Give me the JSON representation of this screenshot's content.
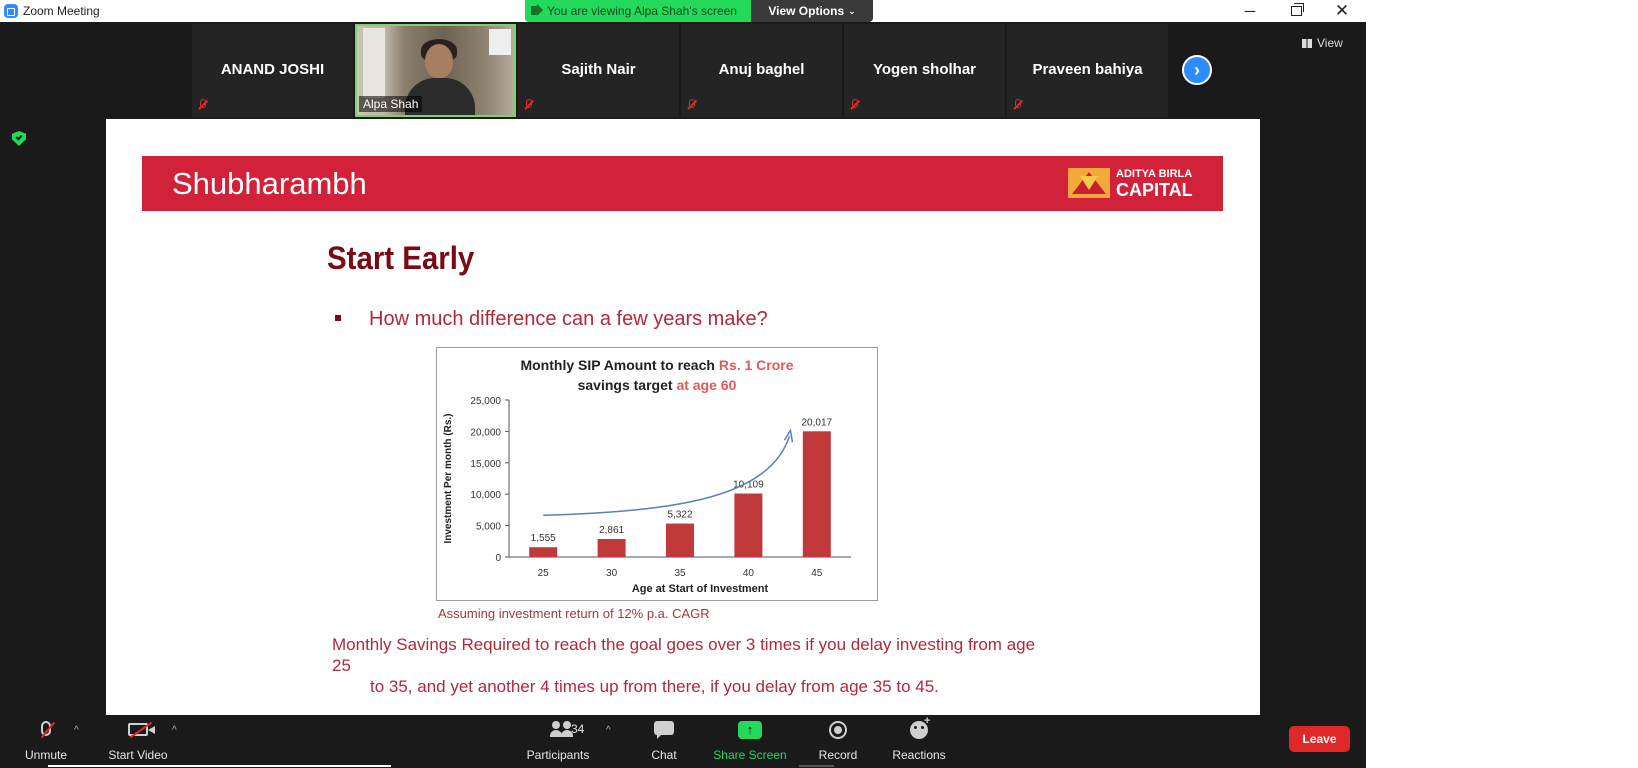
{
  "window": {
    "title": "Zoom Meeting"
  },
  "banner": {
    "viewing_text": "You are viewing Alpa Shah's screen",
    "view_options": "View Options"
  },
  "participants": [
    {
      "name": "ANAND JOSHI"
    },
    {
      "name": "Alpa Shah"
    },
    {
      "name": "Sajith Nair"
    },
    {
      "name": "Anuj baghel"
    },
    {
      "name": "Yogen sholhar"
    },
    {
      "name": "Praveen bahiya"
    }
  ],
  "view_label": "View",
  "slide": {
    "brand": "Shubharambh",
    "logo": {
      "line1": "ADITYA BIRLA",
      "line2": "CAPITAL"
    },
    "title": "Start Early",
    "bullet": "How much difference can a few years make?",
    "footnote": "Assuming investment return of 12% p.a. CAGR",
    "body_line1": "Monthly Savings Required to reach the goal goes over 3 times if you delay investing from age 25",
    "body_line2": "to 35, and yet another 4 times up from there, if you delay from age 35 to 45."
  },
  "chart_data": {
    "type": "bar",
    "title_parts": [
      {
        "text": "Monthly SIP Amount to reach ",
        "color": "#222222"
      },
      {
        "text": "Rs. 1 Crore",
        "color": "#e05a5a"
      },
      {
        "text": "savings target ",
        "color": "#222222",
        "newline": true
      },
      {
        "text": "at age 60",
        "color": "#e05a5a"
      }
    ],
    "xlabel": "Age at Start of Investment",
    "ylabel": "Investment Per month (Rs.)",
    "categories": [
      "25",
      "30",
      "35",
      "40",
      "45"
    ],
    "values": [
      1555,
      2861,
      5322,
      10109,
      20017
    ],
    "value_labels": [
      "1,555",
      "2,861",
      "5,322",
      "10,109",
      "20,017"
    ],
    "yticks": [
      0,
      5000,
      10000,
      15000,
      20000,
      25000
    ],
    "ytick_labels": [
      "0",
      "5,000",
      "10,000",
      "15,000",
      "20,000",
      "25,000"
    ],
    "ylim": [
      0,
      25000
    ],
    "bar_color": "#c0393b",
    "trend_arrow_color": "#5b7fb8",
    "grid": false,
    "legend": "none"
  },
  "toolbar": {
    "unmute": "Unmute",
    "start_video": "Start Video",
    "participants": "Participants",
    "participant_count": "34",
    "chat": "Chat",
    "share_screen": "Share Screen",
    "record": "Record",
    "reactions": "Reactions",
    "leave": "Leave"
  },
  "colors": {
    "share_green": "#23d959",
    "leave_red": "#e02828",
    "zoom_blue": "#2d8cff"
  }
}
